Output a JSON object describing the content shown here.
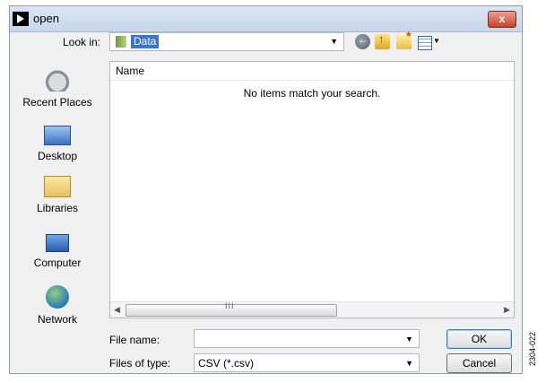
{
  "window": {
    "title": "open",
    "close_label": "x"
  },
  "toolbar": {
    "look_in_label": "Look in:",
    "look_in_value": "Data",
    "icons": [
      "back-icon",
      "up-folder-icon",
      "new-folder-icon",
      "views-menu-icon"
    ]
  },
  "places": [
    {
      "label": "Recent Places",
      "icon": "recent-places-icon"
    },
    {
      "label": "Desktop",
      "icon": "desktop-icon"
    },
    {
      "label": "Libraries",
      "icon": "libraries-icon"
    },
    {
      "label": "Computer",
      "icon": "computer-icon"
    },
    {
      "label": "Network",
      "icon": "network-icon"
    }
  ],
  "file_list": {
    "column_name": "Name",
    "empty_message": "No items match your search.",
    "scroll_grip": "III"
  },
  "file_name": {
    "label": "File name:",
    "value": ""
  },
  "file_type": {
    "label": "Files of type:",
    "value": "CSV (*.csv)"
  },
  "buttons": {
    "ok": "OK",
    "cancel": "Cancel"
  },
  "figure_code": "2304-022",
  "colors": {
    "selection": "#3a74d4",
    "close_button": "#c7432a",
    "titlebar": "#c7d6ea"
  }
}
